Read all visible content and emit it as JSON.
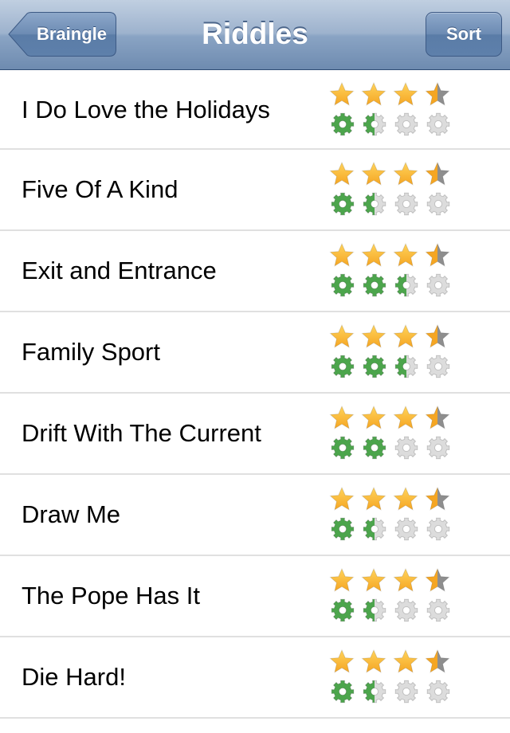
{
  "nav": {
    "back_label": "Braingle",
    "title": "Riddles",
    "sort_label": "Sort"
  },
  "colors": {
    "star": "#f5a623",
    "star_empty": "#8e8e8e",
    "gear": "#4ca54c",
    "gear_empty": "#dcdcdc"
  },
  "scale": {
    "stars_max": 4,
    "gears_max": 4
  },
  "riddles": [
    {
      "title": "I Do Love the Holidays",
      "stars": 3.5,
      "gears": 1.5
    },
    {
      "title": "Five Of A Kind",
      "stars": 3.5,
      "gears": 1.5
    },
    {
      "title": "Exit and Entrance",
      "stars": 3.5,
      "gears": 2.5
    },
    {
      "title": "Family Sport",
      "stars": 3.5,
      "gears": 2.5
    },
    {
      "title": "Drift With The Current",
      "stars": 3.5,
      "gears": 2
    },
    {
      "title": "Draw Me",
      "stars": 3.5,
      "gears": 1.5
    },
    {
      "title": "The Pope Has It",
      "stars": 3.5,
      "gears": 1.5
    },
    {
      "title": "Die Hard!",
      "stars": 3.5,
      "gears": 1.5
    }
  ]
}
